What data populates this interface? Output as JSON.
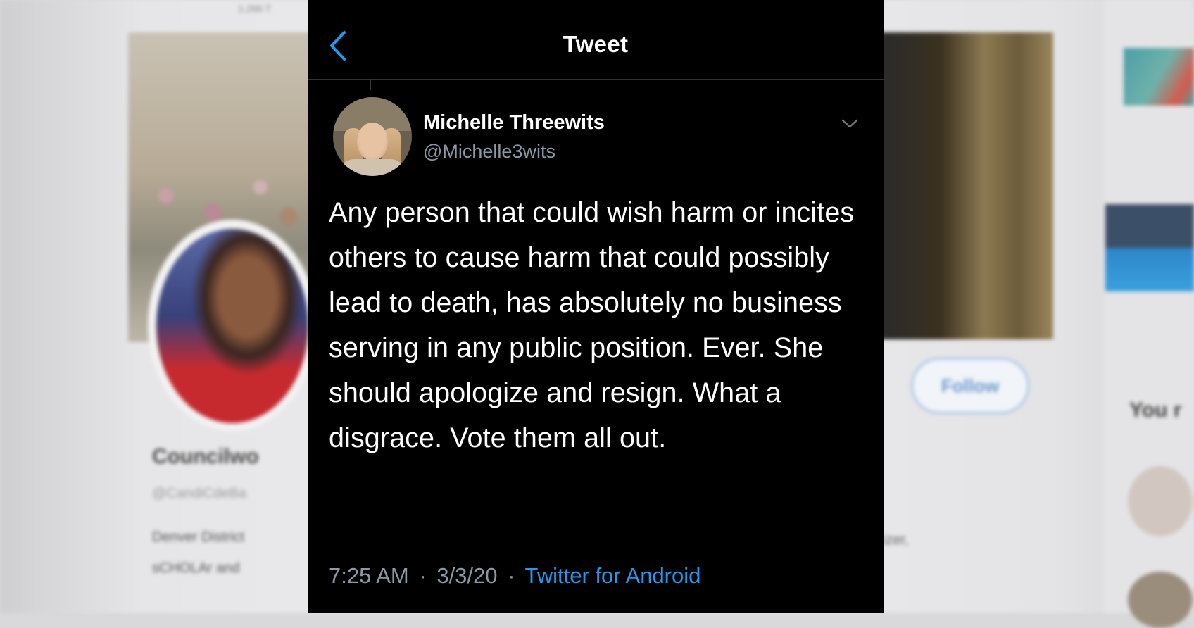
{
  "background": {
    "top_text": "1,266 T",
    "profile_name": "Councilwo",
    "profile_handle": "@CandiCdeBa",
    "bio_line1": "Denver District",
    "bio_line2": "sCHOLAr and",
    "follow_label": "Follow",
    "right_bio": "izer,",
    "right_rail_heading": "You r"
  },
  "tweet_view": {
    "title": "Tweet",
    "author": {
      "display_name": "Michelle Threewits",
      "handle": "@Michelle3wits"
    },
    "text": "Any person that could wish harm or incites others to cause harm that could possibly lead to death, has absolutely no business serving in any public position. Ever. She should apologize and resign. What a disgrace. Vote them all out.",
    "time": "7:25 AM",
    "date": "3/3/20",
    "separator": "·",
    "source": "Twitter for Android"
  },
  "colors": {
    "background": "#000000",
    "accent": "#1d9bf0",
    "secondary_text": "#8b98a5"
  },
  "icons": {
    "back": "chevron-left-icon",
    "menu": "chevron-down-icon"
  }
}
